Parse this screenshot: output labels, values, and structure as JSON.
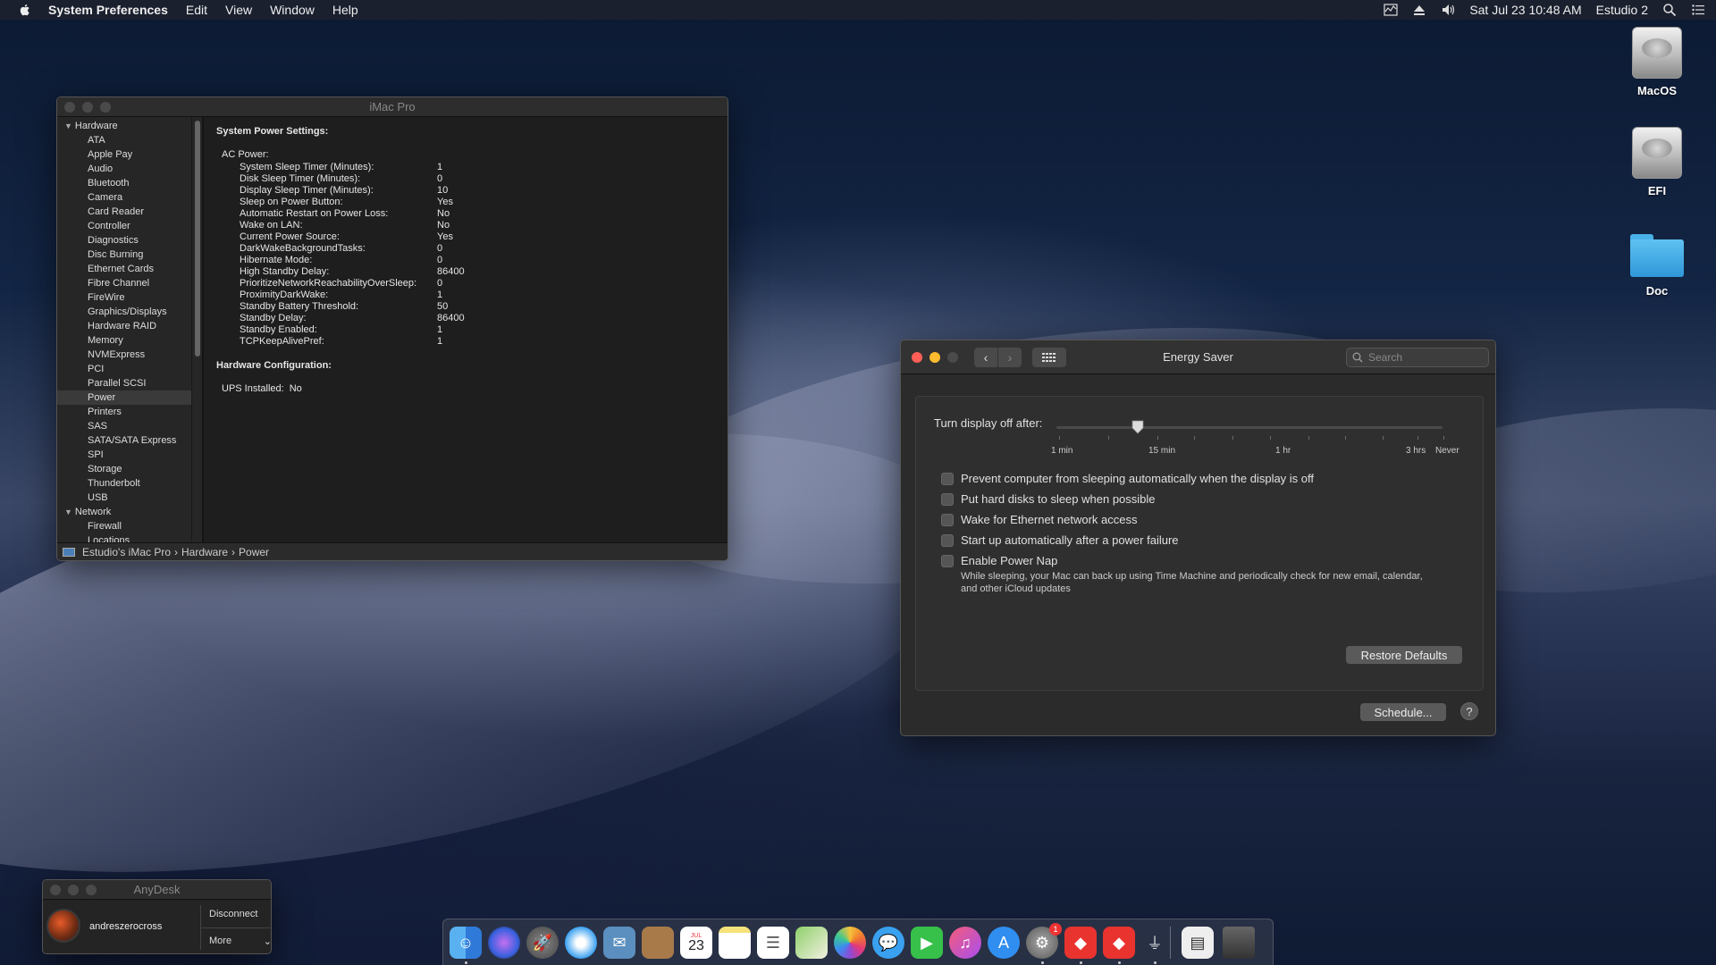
{
  "menubar": {
    "app": "System Preferences",
    "items": [
      "Edit",
      "View",
      "Window",
      "Help"
    ],
    "clock": "Sat Jul 23  10:48 AM",
    "user": "Estudio 2"
  },
  "desktop_icons": [
    {
      "label": "MacOS",
      "icon": "hard-disk-icon"
    },
    {
      "label": "EFI",
      "icon": "hard-disk-icon"
    },
    {
      "label": "Doc",
      "icon": "folder-icon"
    }
  ],
  "sysinfo": {
    "title": "iMac Pro",
    "sidebar": {
      "hardware": "Hardware",
      "hardware_items": [
        "ATA",
        "Apple Pay",
        "Audio",
        "Bluetooth",
        "Camera",
        "Card Reader",
        "Controller",
        "Diagnostics",
        "Disc Burning",
        "Ethernet Cards",
        "Fibre Channel",
        "FireWire",
        "Graphics/Displays",
        "Hardware RAID",
        "Memory",
        "NVMExpress",
        "PCI",
        "Parallel SCSI",
        "Power",
        "Printers",
        "SAS",
        "SATA/SATA Express",
        "SPI",
        "Storage",
        "Thunderbolt",
        "USB"
      ],
      "selected": "Power",
      "network": "Network",
      "network_items": [
        "Firewall",
        "Locations"
      ]
    },
    "content": {
      "heading": "System Power Settings:",
      "ac_power": "AC Power:",
      "settings": [
        {
          "k": "System Sleep Timer (Minutes):",
          "v": "1"
        },
        {
          "k": "Disk Sleep Timer (Minutes):",
          "v": "0"
        },
        {
          "k": "Display Sleep Timer (Minutes):",
          "v": "10"
        },
        {
          "k": "Sleep on Power Button:",
          "v": "Yes"
        },
        {
          "k": "Automatic Restart on Power Loss:",
          "v": "No"
        },
        {
          "k": "Wake on LAN:",
          "v": "No"
        },
        {
          "k": "Current Power Source:",
          "v": "Yes"
        },
        {
          "k": "DarkWakeBackgroundTasks:",
          "v": "0"
        },
        {
          "k": "Hibernate Mode:",
          "v": "0"
        },
        {
          "k": "High Standby Delay:",
          "v": "86400"
        },
        {
          "k": "PrioritizeNetworkReachabilityOverSleep:",
          "v": "0"
        },
        {
          "k": "ProximityDarkWake:",
          "v": "1"
        },
        {
          "k": "Standby Battery Threshold:",
          "v": "50"
        },
        {
          "k": "Standby Delay:",
          "v": "86400"
        },
        {
          "k": "Standby Enabled:",
          "v": "1"
        },
        {
          "k": "TCPKeepAlivePref:",
          "v": "1"
        }
      ],
      "hw_heading": "Hardware Configuration:",
      "ups_label": "UPS Installed:",
      "ups_value": "No"
    },
    "path": [
      "Estudio's iMac Pro",
      "Hardware",
      "Power"
    ]
  },
  "energy": {
    "title": "Energy Saver",
    "search_placeholder": "Search",
    "slider_label": "Turn display off after:",
    "slider_value": "10 min",
    "tick_labels": [
      "1 min",
      "15 min",
      "1 hr",
      "3 hrs",
      "Never"
    ],
    "checkboxes": [
      {
        "label": "Prevent computer from sleeping automatically when the display is off",
        "checked": false
      },
      {
        "label": "Put hard disks to sleep when possible",
        "checked": false
      },
      {
        "label": "Wake for Ethernet network access",
        "checked": false
      },
      {
        "label": "Start up automatically after a power failure",
        "checked": false
      },
      {
        "label": "Enable Power Nap",
        "checked": false
      }
    ],
    "powernap_desc": "While sleeping, your Mac can back up using Time Machine and periodically check for new email, calendar, and other iCloud updates",
    "restore_label": "Restore Defaults",
    "schedule_label": "Schedule...",
    "help_label": "?"
  },
  "anydesk": {
    "title": "AnyDesk",
    "user": "andreszerocross",
    "disconnect": "Disconnect",
    "more": "More"
  },
  "dock": {
    "calendar_day": "23",
    "calendar_month": "JUL",
    "prefs_badge": "1",
    "apps": [
      "finder-icon",
      "siri-icon",
      "launchpad-icon",
      "safari-icon",
      "mail-icon",
      "contacts-icon",
      "calendar-icon",
      "notes-icon",
      "reminders-icon",
      "maps-icon",
      "photos-icon",
      "messages-icon",
      "facetime-icon",
      "itunes-icon",
      "app-store-icon",
      "system-preferences-icon",
      "anydesk-icon",
      "anydesk-alt-icon",
      "usb-icon",
      "document-icon",
      "trash-icon"
    ]
  },
  "colors": {
    "accent": "#4a90d9",
    "close": "#ff5f57",
    "minimize": "#febc2e"
  }
}
